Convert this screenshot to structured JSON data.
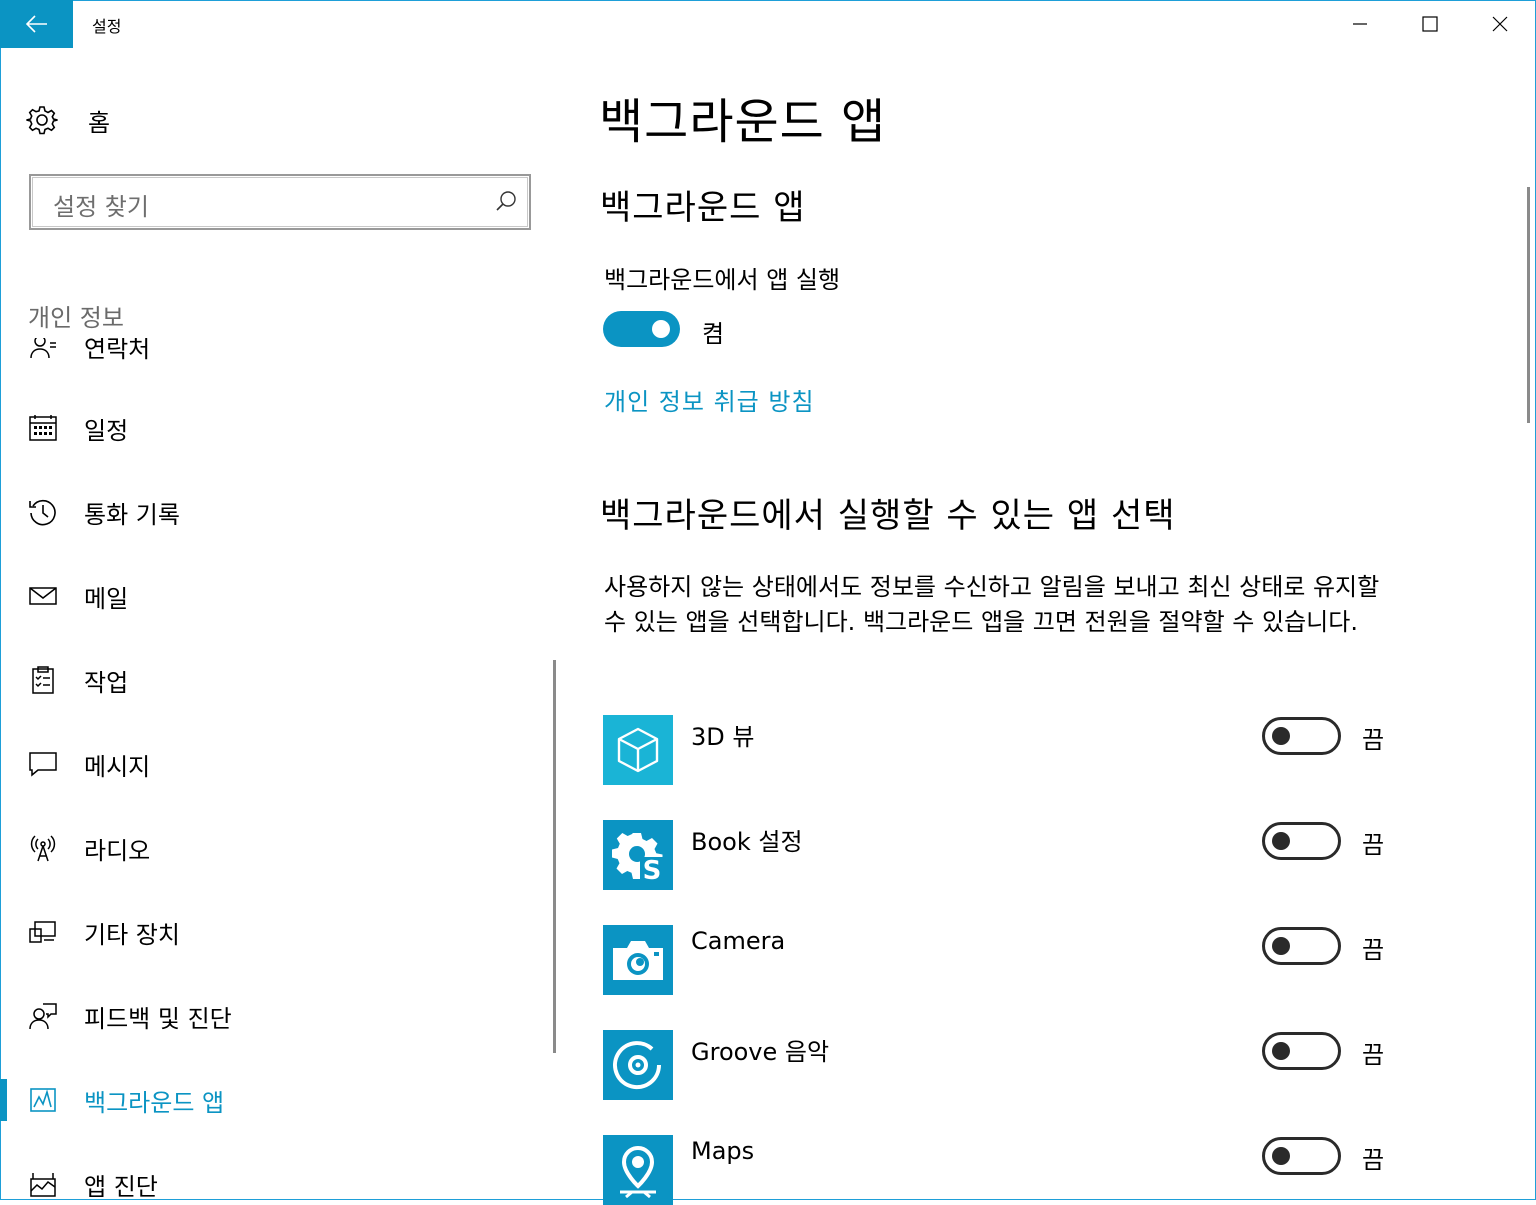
{
  "window": {
    "title": "설정",
    "back_icon": "arrow-left-icon",
    "minimize_icon": "minimize-icon",
    "maximize_icon": "maximize-icon",
    "close_icon": "close-icon",
    "accent": "#0b94c3"
  },
  "sidebar": {
    "home_label": "홈",
    "search_placeholder": "설정 찾기",
    "section_title": "개인 정보",
    "items": [
      {
        "label": "연락처",
        "icon": "contacts-icon"
      },
      {
        "label": "일정",
        "icon": "calendar-icon"
      },
      {
        "label": "통화 기록",
        "icon": "call-history-icon"
      },
      {
        "label": "메일",
        "icon": "mail-icon"
      },
      {
        "label": "작업",
        "icon": "tasks-icon"
      },
      {
        "label": "메시지",
        "icon": "message-icon"
      },
      {
        "label": "라디오",
        "icon": "radio-icon"
      },
      {
        "label": "기타 장치",
        "icon": "other-devices-icon"
      },
      {
        "label": "피드백 및 진단",
        "icon": "feedback-icon"
      },
      {
        "label": "백그라운드 앱",
        "icon": "background-apps-icon",
        "active": true
      },
      {
        "label": "앱 진단",
        "icon": "app-diagnostics-icon"
      }
    ]
  },
  "main": {
    "page_title": "백그라운드 앱",
    "section1_title": "백그라운드 앱",
    "run_in_background_label": "백그라운드에서 앱 실행",
    "run_in_background_state": "켬",
    "run_in_background_on": true,
    "privacy_link": "개인 정보 취급 방침",
    "section2_title": "백그라운드에서 실행할 수 있는 앱 선택",
    "description": "사용하지 않는 상태에서도 정보를 수신하고 알림을 보내고 최신 상태로 유지할 수 있는 앱을 선택합니다. 백그라운드 앱을 끄면 전원을 절약할 수 있습니다.",
    "apps": [
      {
        "name": "3D 뷰",
        "state": "끔",
        "on": false,
        "icon": "3d-viewer-cube-icon",
        "tile_color": "#1ab4d6"
      },
      {
        "name": "Book 설정",
        "state": "끔",
        "on": false,
        "icon": "book-settings-gear-icon",
        "tile_color": "#0b94c3"
      },
      {
        "name": "Camera",
        "state": "끔",
        "on": false,
        "icon": "camera-icon",
        "tile_color": "#0b94c3"
      },
      {
        "name": "Groove 음악",
        "state": "끔",
        "on": false,
        "icon": "groove-music-icon",
        "tile_color": "#0b94c3"
      },
      {
        "name": "Maps",
        "state": "끔",
        "on": false,
        "icon": "maps-pin-icon",
        "tile_color": "#0b94c3"
      }
    ]
  }
}
